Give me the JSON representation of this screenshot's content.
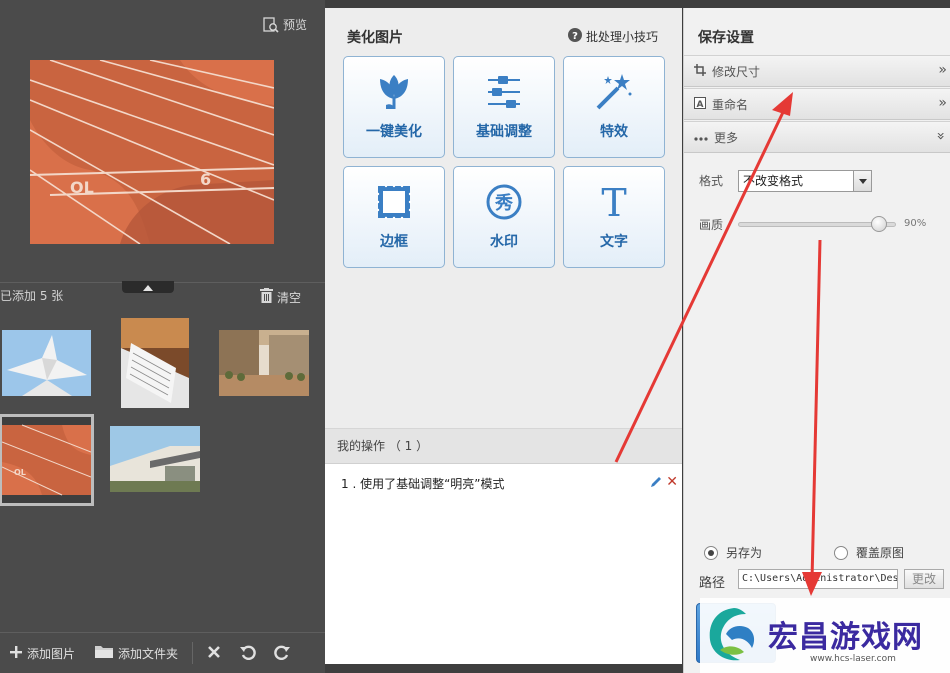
{
  "left": {
    "preview_label": "预览",
    "count_label": "已添加 5 张",
    "clear_label": "清空",
    "toolbar": {
      "add_image_label": "添加图片",
      "add_folder_label": "添加文件夹"
    }
  },
  "middle": {
    "title": "美化图片",
    "tips_label": "批处理小技巧",
    "tools": [
      {
        "label": "一键美化",
        "icon": "tulip-icon"
      },
      {
        "label": "基础调整",
        "icon": "sliders-icon"
      },
      {
        "label": "特效",
        "icon": "magic-wand-icon"
      },
      {
        "label": "边框",
        "icon": "frame-icon"
      },
      {
        "label": "水印",
        "icon": "watermark-icon"
      },
      {
        "label": "文字",
        "icon": "text-icon"
      }
    ],
    "ops_header": "我的操作 （ 1 ）",
    "ops": [
      {
        "text": "1 . 使用了基础调整“明亮”模式"
      }
    ]
  },
  "right": {
    "title": "保存设置",
    "sections": [
      {
        "label": "修改尺寸",
        "icon": "crop-icon"
      },
      {
        "label": "重命名",
        "icon": "rename-icon"
      },
      {
        "label": "更多",
        "icon": "more-icon"
      }
    ],
    "format_label": "格式",
    "format_value": "不改变格式",
    "quality_label": "画质",
    "quality_value": "90%",
    "quality_fraction": 0.9,
    "radio_save_as": "另存为",
    "radio_overwrite": "覆盖原图",
    "path_label": "路径",
    "path_value": "C:\\Users\\Administrator\\Desktop",
    "change_label": "更改"
  },
  "watermark": {
    "text": "宏昌游戏网",
    "url": "www.hcs-laser.com"
  },
  "colors": {
    "accent": "#2467a8",
    "annotation": "#e53935"
  }
}
